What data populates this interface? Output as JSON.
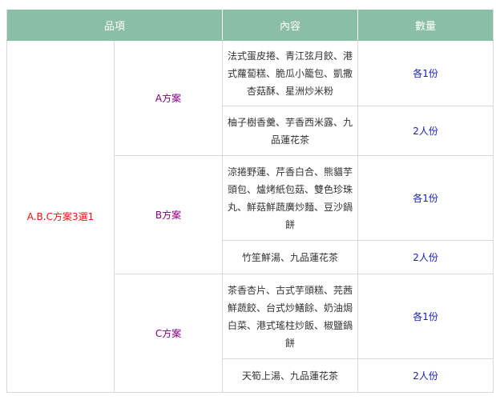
{
  "header": {
    "item_label": "品項",
    "content_label": "內容",
    "quantity_label": "數量"
  },
  "category": "A.B.C方案3選1",
  "plans": [
    {
      "name": "A方案",
      "rows": [
        {
          "content": "法式蛋皮捲、青江弦月餃、港式蘿蔔糕、脆瓜小籠包、凱撒杏菇酥、星洲炒米粉",
          "quantity": "各1份"
        },
        {
          "content": "柚子樹香羹、芋香西米露、九品蓮花茶",
          "quantity": "2人份"
        }
      ]
    },
    {
      "name": "B方案",
      "rows": [
        {
          "content": "涼捲野蓮、芹香白合、熊貓芋頭包、爐烤紙包菇、雙色珍珠丸、鮮菇鮮蔬廣炒麵、豆沙鍋餅",
          "quantity": "各1份"
        },
        {
          "content": "竹笙鮮湯、九品蓮花茶",
          "quantity": "2人份"
        }
      ]
    },
    {
      "name": "C方案",
      "rows": [
        {
          "content": "茶香杏片、古式芋頭糕、芫茜鮮蔬餃、台式炒鱔餘、奶油焗白菜、港式瑤柱炒飯、椒鹽鍋餅",
          "quantity": "各1份"
        },
        {
          "content": "天筍上湯、九品蓮花茶",
          "quantity": "2人份"
        }
      ]
    }
  ]
}
